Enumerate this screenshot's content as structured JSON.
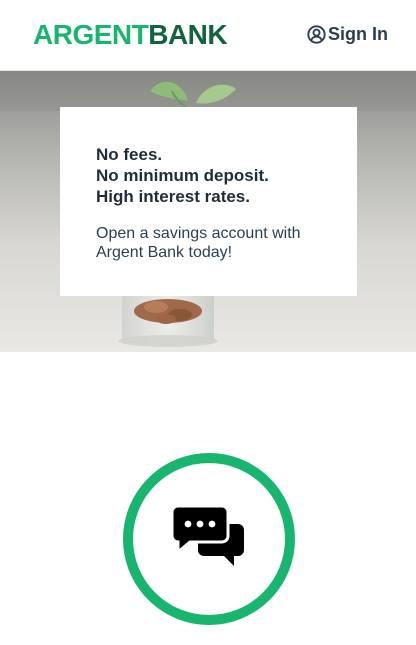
{
  "header": {
    "logo_part1": "ARGENT",
    "logo_part2": "BANK",
    "sign_in_label": "Sign In",
    "sign_in_icon": "user-circle-icon"
  },
  "promo": {
    "heading_lines": [
      "No fees.",
      "No minimum deposit.",
      "High interest rates."
    ],
    "subtext": "Open a savings account with Argent Bank today!"
  },
  "features": {
    "chat_icon": "chat-bubbles-icon"
  },
  "colors": {
    "brand_green": "#18b56e",
    "brand_dark_green": "#11643f",
    "text_dark": "#2c3e50"
  }
}
